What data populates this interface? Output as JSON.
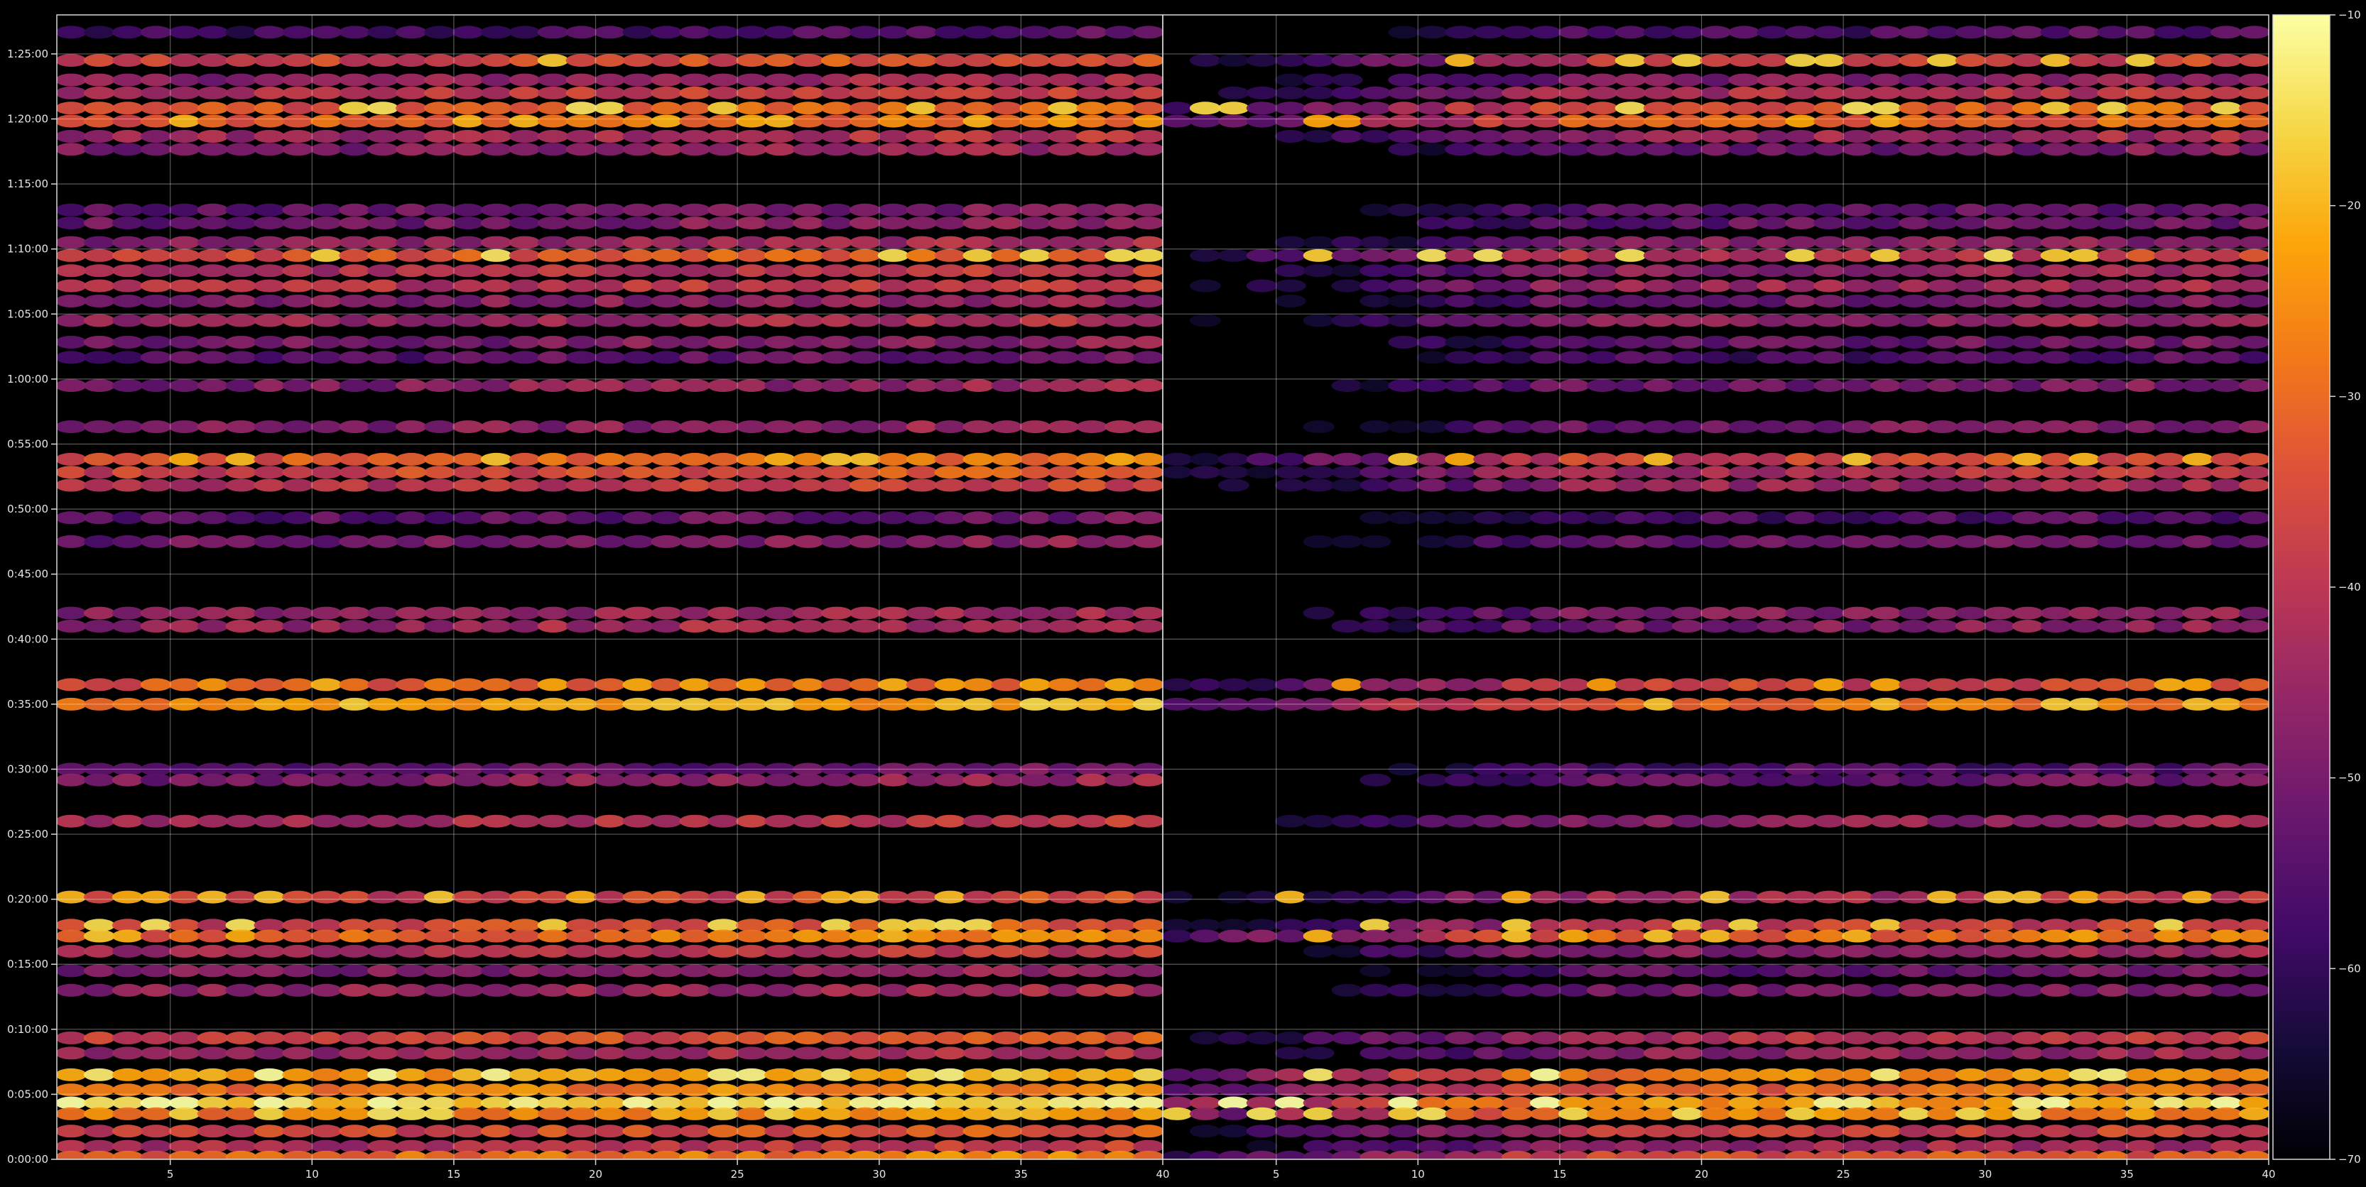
{
  "chart_data": {
    "type": "heatmap",
    "title": "",
    "colormap": "inferno",
    "background": "#000000",
    "grid": true,
    "panels": [
      {
        "name": "",
        "x_ticks": [
          5,
          10,
          15,
          20,
          25,
          30,
          35,
          40
        ],
        "x_tick_labels": [
          "5",
          "10",
          "15",
          "20",
          "25",
          "30",
          "35",
          "40"
        ],
        "xlim": [
          1,
          40
        ],
        "xlabel": "",
        "ylabel": ""
      },
      {
        "name": "",
        "x_ticks": [
          5,
          10,
          15,
          20,
          25,
          30,
          35,
          40
        ],
        "x_tick_labels": [
          "5",
          "10",
          "15",
          "20",
          "25",
          "30",
          "35",
          "40"
        ],
        "xlim": [
          1,
          40
        ],
        "xlabel": "",
        "ylabel": ""
      }
    ],
    "y_ticks_seconds": [
      0,
      300,
      600,
      900,
      1200,
      1500,
      1800,
      2100,
      2400,
      2700,
      3000,
      3300,
      3600,
      3900,
      4200,
      4500,
      4800,
      5100
    ],
    "y_tick_labels": [
      "0:00:00",
      "0:05:00",
      "0:10:00",
      "0:15:00",
      "0:20:00",
      "0:25:00",
      "0:30:00",
      "0:35:00",
      "0:40:00",
      "0:45:00",
      "0:50:00",
      "0:55:00",
      "1:00:00",
      "1:05:00",
      "1:10:00",
      "1:15:00",
      "1:20:00",
      "1:25:00"
    ],
    "ylim_seconds": [
      0,
      5280
    ],
    "colorbar": {
      "range": [
        -70,
        -10
      ],
      "ticks": [
        -70,
        -60,
        -50,
        -40,
        -30,
        -20,
        -10
      ],
      "tick_labels": [
        "−70",
        "−60",
        "−50",
        "−40",
        "−30",
        "−20",
        "−10"
      ]
    },
    "bands": [
      {
        "t": 5200,
        "panel1": -60,
        "panel2": -60
      },
      {
        "t": 5070,
        "panel1": -38,
        "panel2": -42,
        "peak": -20
      },
      {
        "t": 4980,
        "panel1": -48,
        "panel2": -52
      },
      {
        "t": 4920,
        "panel1": -42,
        "panel2": -45
      },
      {
        "t": 4850,
        "panel1": -35,
        "panel2": -36,
        "peak": -18
      },
      {
        "t": 4790,
        "panel1": -34,
        "panel2": -36,
        "peak": -24
      },
      {
        "t": 4720,
        "panel1": -45,
        "panel2": -48
      },
      {
        "t": 4660,
        "panel1": -50,
        "panel2": -54
      },
      {
        "t": 4380,
        "panel1": -54,
        "panel2": -58
      },
      {
        "t": 4320,
        "panel1": -52,
        "panel2": -56
      },
      {
        "t": 4230,
        "panel1": -48,
        "panel2": -52
      },
      {
        "t": 4170,
        "panel1": -36,
        "panel2": -42,
        "peak": -18
      },
      {
        "t": 4100,
        "panel1": -44,
        "panel2": -50
      },
      {
        "t": 4030,
        "panel1": -42,
        "panel2": -48
      },
      {
        "t": 3960,
        "panel1": -50,
        "panel2": -54
      },
      {
        "t": 3870,
        "panel1": -46,
        "panel2": -50
      },
      {
        "t": 3770,
        "panel1": -52,
        "panel2": -56
      },
      {
        "t": 3700,
        "panel1": -56,
        "panel2": -60
      },
      {
        "t": 3570,
        "panel1": -50,
        "panel2": -54
      },
      {
        "t": 3380,
        "panel1": -50,
        "panel2": -54
      },
      {
        "t": 3230,
        "panel1": -34,
        "panel2": -40,
        "peak": -22
      },
      {
        "t": 3170,
        "panel1": -38,
        "panel2": -45
      },
      {
        "t": 3110,
        "panel1": -42,
        "panel2": -48
      },
      {
        "t": 2960,
        "panel1": -56,
        "panel2": -60
      },
      {
        "t": 2850,
        "panel1": -52,
        "panel2": -56
      },
      {
        "t": 2520,
        "panel1": -48,
        "panel2": -52
      },
      {
        "t": 2460,
        "panel1": -46,
        "panel2": -52
      },
      {
        "t": 2190,
        "panel1": -34,
        "panel2": -40,
        "peak": -24
      },
      {
        "t": 2100,
        "panel1": -26,
        "panel2": -32,
        "peak": -20
      },
      {
        "t": 1800,
        "panel1": -56,
        "panel2": -60
      },
      {
        "t": 1750,
        "panel1": -50,
        "panel2": -56
      },
      {
        "t": 1560,
        "panel1": -44,
        "panel2": -50
      },
      {
        "t": 1210,
        "panel1": -40,
        "panel2": -46,
        "peak": -22
      },
      {
        "t": 1080,
        "panel1": -38,
        "panel2": -42,
        "peak": -18
      },
      {
        "t": 1030,
        "panel1": -32,
        "panel2": -34,
        "peak": -22
      },
      {
        "t": 960,
        "panel1": -44,
        "panel2": -50
      },
      {
        "t": 870,
        "panel1": -50,
        "panel2": -56
      },
      {
        "t": 780,
        "panel1": -48,
        "panel2": -54
      },
      {
        "t": 560,
        "panel1": -38,
        "panel2": -44
      },
      {
        "t": 490,
        "panel1": -46,
        "panel2": -50
      },
      {
        "t": 390,
        "panel1": -24,
        "panel2": -30,
        "peak": -14
      },
      {
        "t": 320,
        "panel1": -30,
        "panel2": -34
      },
      {
        "t": 260,
        "panel1": -18,
        "panel2": -26,
        "peak": -12
      },
      {
        "t": 210,
        "panel1": -28,
        "panel2": -30,
        "peak": -18
      },
      {
        "t": 130,
        "panel1": -38,
        "panel2": -42
      },
      {
        "t": 60,
        "panel1": -44,
        "panel2": -48
      },
      {
        "t": 10,
        "panel1": -32,
        "panel2": -38
      }
    ]
  }
}
